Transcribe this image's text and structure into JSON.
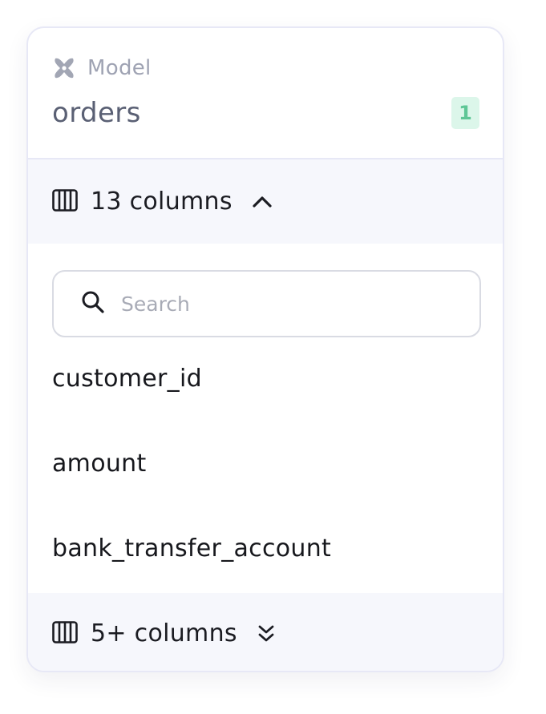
{
  "node": {
    "type_label": "Model",
    "type_icon": "dbt-logo-icon",
    "title": "orders",
    "badge_count": "1"
  },
  "columns_header": {
    "icon": "table-columns-icon",
    "label": "13 columns",
    "toggle_icon": "chevron-up-icon"
  },
  "search": {
    "placeholder": "Search",
    "value": ""
  },
  "columns": [
    "customer_id",
    "amount",
    "bank_transfer_account"
  ],
  "more_columns": {
    "icon": "table-columns-icon",
    "label": "5+ columns",
    "toggle_icon": "double-chevron-down-icon"
  },
  "colors": {
    "badge_bg": "#dcf6ea",
    "badge_text": "#5fc696",
    "border": "#e7e8f6",
    "bar_bg": "#f6f7fc"
  }
}
